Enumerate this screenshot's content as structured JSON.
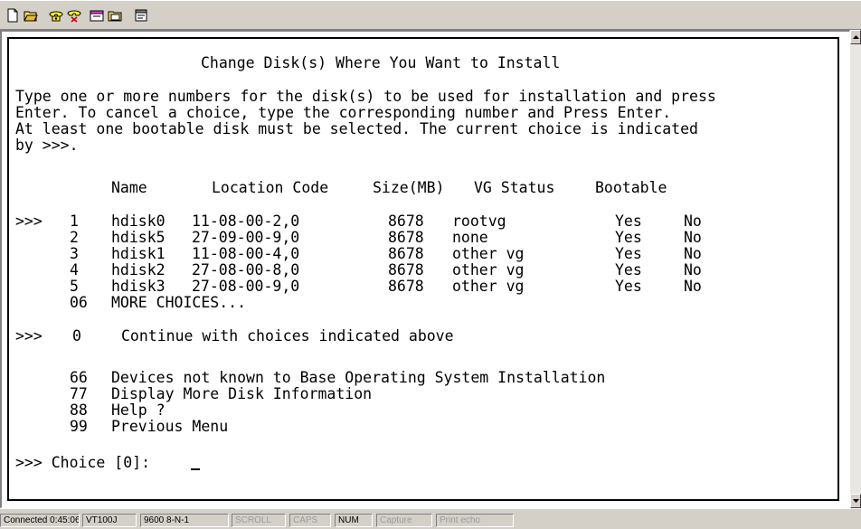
{
  "toolbar": {
    "icons": [
      "new-session-icon",
      "open-session-icon",
      "connect-icon",
      "disconnect-icon",
      "send-file-icon",
      "receive-file-icon",
      "properties-icon"
    ]
  },
  "terminal": {
    "title": "Change Disk(s) Where You Want to Install",
    "intro": [
      "Type one or more numbers for the disk(s) to be used for installation and press",
      "Enter. To cancel a choice, type the corresponding number and Press Enter.",
      "At least one bootable disk must be selected. The current choice is indicated",
      "by >>>."
    ],
    "column_headers": [
      "Name",
      "Location Code",
      "Size(MB)",
      "VG Status",
      "Bootable"
    ],
    "disks": [
      {
        "marker": ">>>",
        "number": "1",
        "name": "hdisk0",
        "location": "11-08-00-2,0",
        "size": "8678",
        "vg_status": "rootvg",
        "bootable": "Yes",
        "extra": "No"
      },
      {
        "marker": "",
        "number": "2",
        "name": "hdisk5",
        "location": "27-09-00-9,0",
        "size": "8678",
        "vg_status": "none",
        "bootable": "Yes",
        "extra": "No"
      },
      {
        "marker": "",
        "number": "3",
        "name": "hdisk1",
        "location": "11-08-00-4,0",
        "size": "8678",
        "vg_status": "other vg",
        "bootable": "Yes",
        "extra": "No"
      },
      {
        "marker": "",
        "number": "4",
        "name": "hdisk2",
        "location": "27-08-00-8,0",
        "size": "8678",
        "vg_status": "other vg",
        "bootable": "Yes",
        "extra": "No"
      },
      {
        "marker": "",
        "number": "5",
        "name": "hdisk3",
        "location": "27-08-00-9,0",
        "size": "8678",
        "vg_status": "other vg",
        "bootable": "Yes",
        "extra": "No"
      }
    ],
    "more_choices": {
      "number": "06",
      "label": "MORE CHOICES..."
    },
    "continue_option": {
      "marker": ">>>",
      "number": "0",
      "label": "Continue with choices indicated above"
    },
    "menu_options": [
      {
        "number": "66",
        "label": "Devices not known to Base Operating System Installation"
      },
      {
        "number": "77",
        "label": "Display More Disk Information"
      },
      {
        "number": "88",
        "label": "Help ?"
      },
      {
        "number": "99",
        "label": "Previous Menu"
      }
    ],
    "prompt": ">>> Choice [0]:"
  },
  "statusbar": {
    "connected": "Connected 0:45:06",
    "emulation": "VT100J",
    "port_settings": "9600 8-N-1",
    "scroll": "SCROLL",
    "caps": "CAPS",
    "num": "NUM",
    "capture": "Capture",
    "print_echo": "Print echo"
  }
}
